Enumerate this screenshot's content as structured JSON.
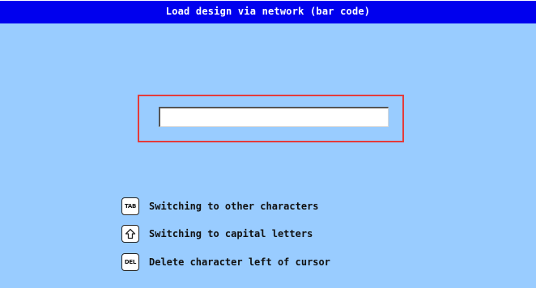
{
  "window": {
    "title": "Load design via network (bar code)"
  },
  "barcode_input": {
    "value": ""
  },
  "hints": [
    {
      "key_label": "TAB",
      "key_icon": "tab-key-icon",
      "text": "Switching to other characters"
    },
    {
      "key_label": "",
      "key_icon": "shift-arrow-up-icon",
      "text": "Switching to capital letters"
    },
    {
      "key_label": "DEL",
      "key_icon": "del-key-icon",
      "text": "Delete character left of cursor"
    }
  ],
  "colors": {
    "background": "#99ccff",
    "titlebar": "#0000ee",
    "focus_frame": "#e43b3b"
  }
}
